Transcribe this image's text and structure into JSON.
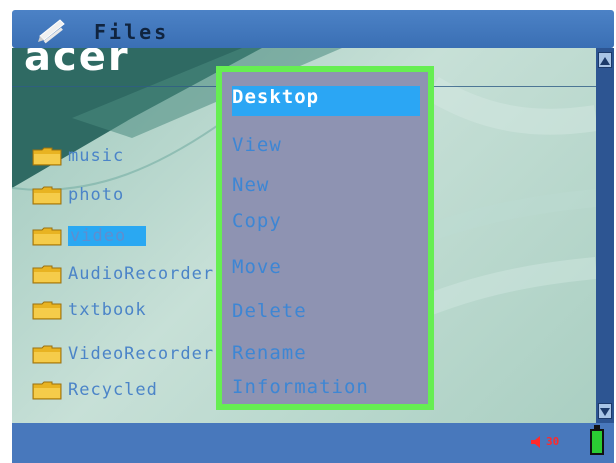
{
  "window": {
    "title": "Files",
    "title_icon": "files-pen-icon"
  },
  "background": {
    "logo_text": "acer"
  },
  "files": [
    {
      "name": "music",
      "icon": "folder-icon",
      "selected": false
    },
    {
      "name": "photo",
      "icon": "folder-icon",
      "selected": false
    },
    {
      "name": "video",
      "icon": "folder-icon",
      "selected": true
    },
    {
      "name": "AudioRecorder",
      "icon": "folder-icon",
      "selected": false
    },
    {
      "name": "txtbook",
      "icon": "folder-icon",
      "selected": false
    },
    {
      "name": "VideoRecorder",
      "icon": "folder-icon",
      "selected": false
    },
    {
      "name": "Recycled",
      "icon": "folder-icon",
      "selected": false
    }
  ],
  "context_menu": {
    "items": [
      "Desktop",
      "View",
      "New",
      "Copy",
      "Move",
      "Delete",
      "Rename",
      "Information"
    ],
    "active_item": "Desktop",
    "border_color": "#66ee52"
  },
  "status": {
    "volume_text": "30",
    "volume_icon": "speaker-icon",
    "battery_icon": "battery-icon",
    "colors": {
      "bar": "#4878bc",
      "volume": "#ff2a2a",
      "battery": "#2bcc33"
    }
  }
}
